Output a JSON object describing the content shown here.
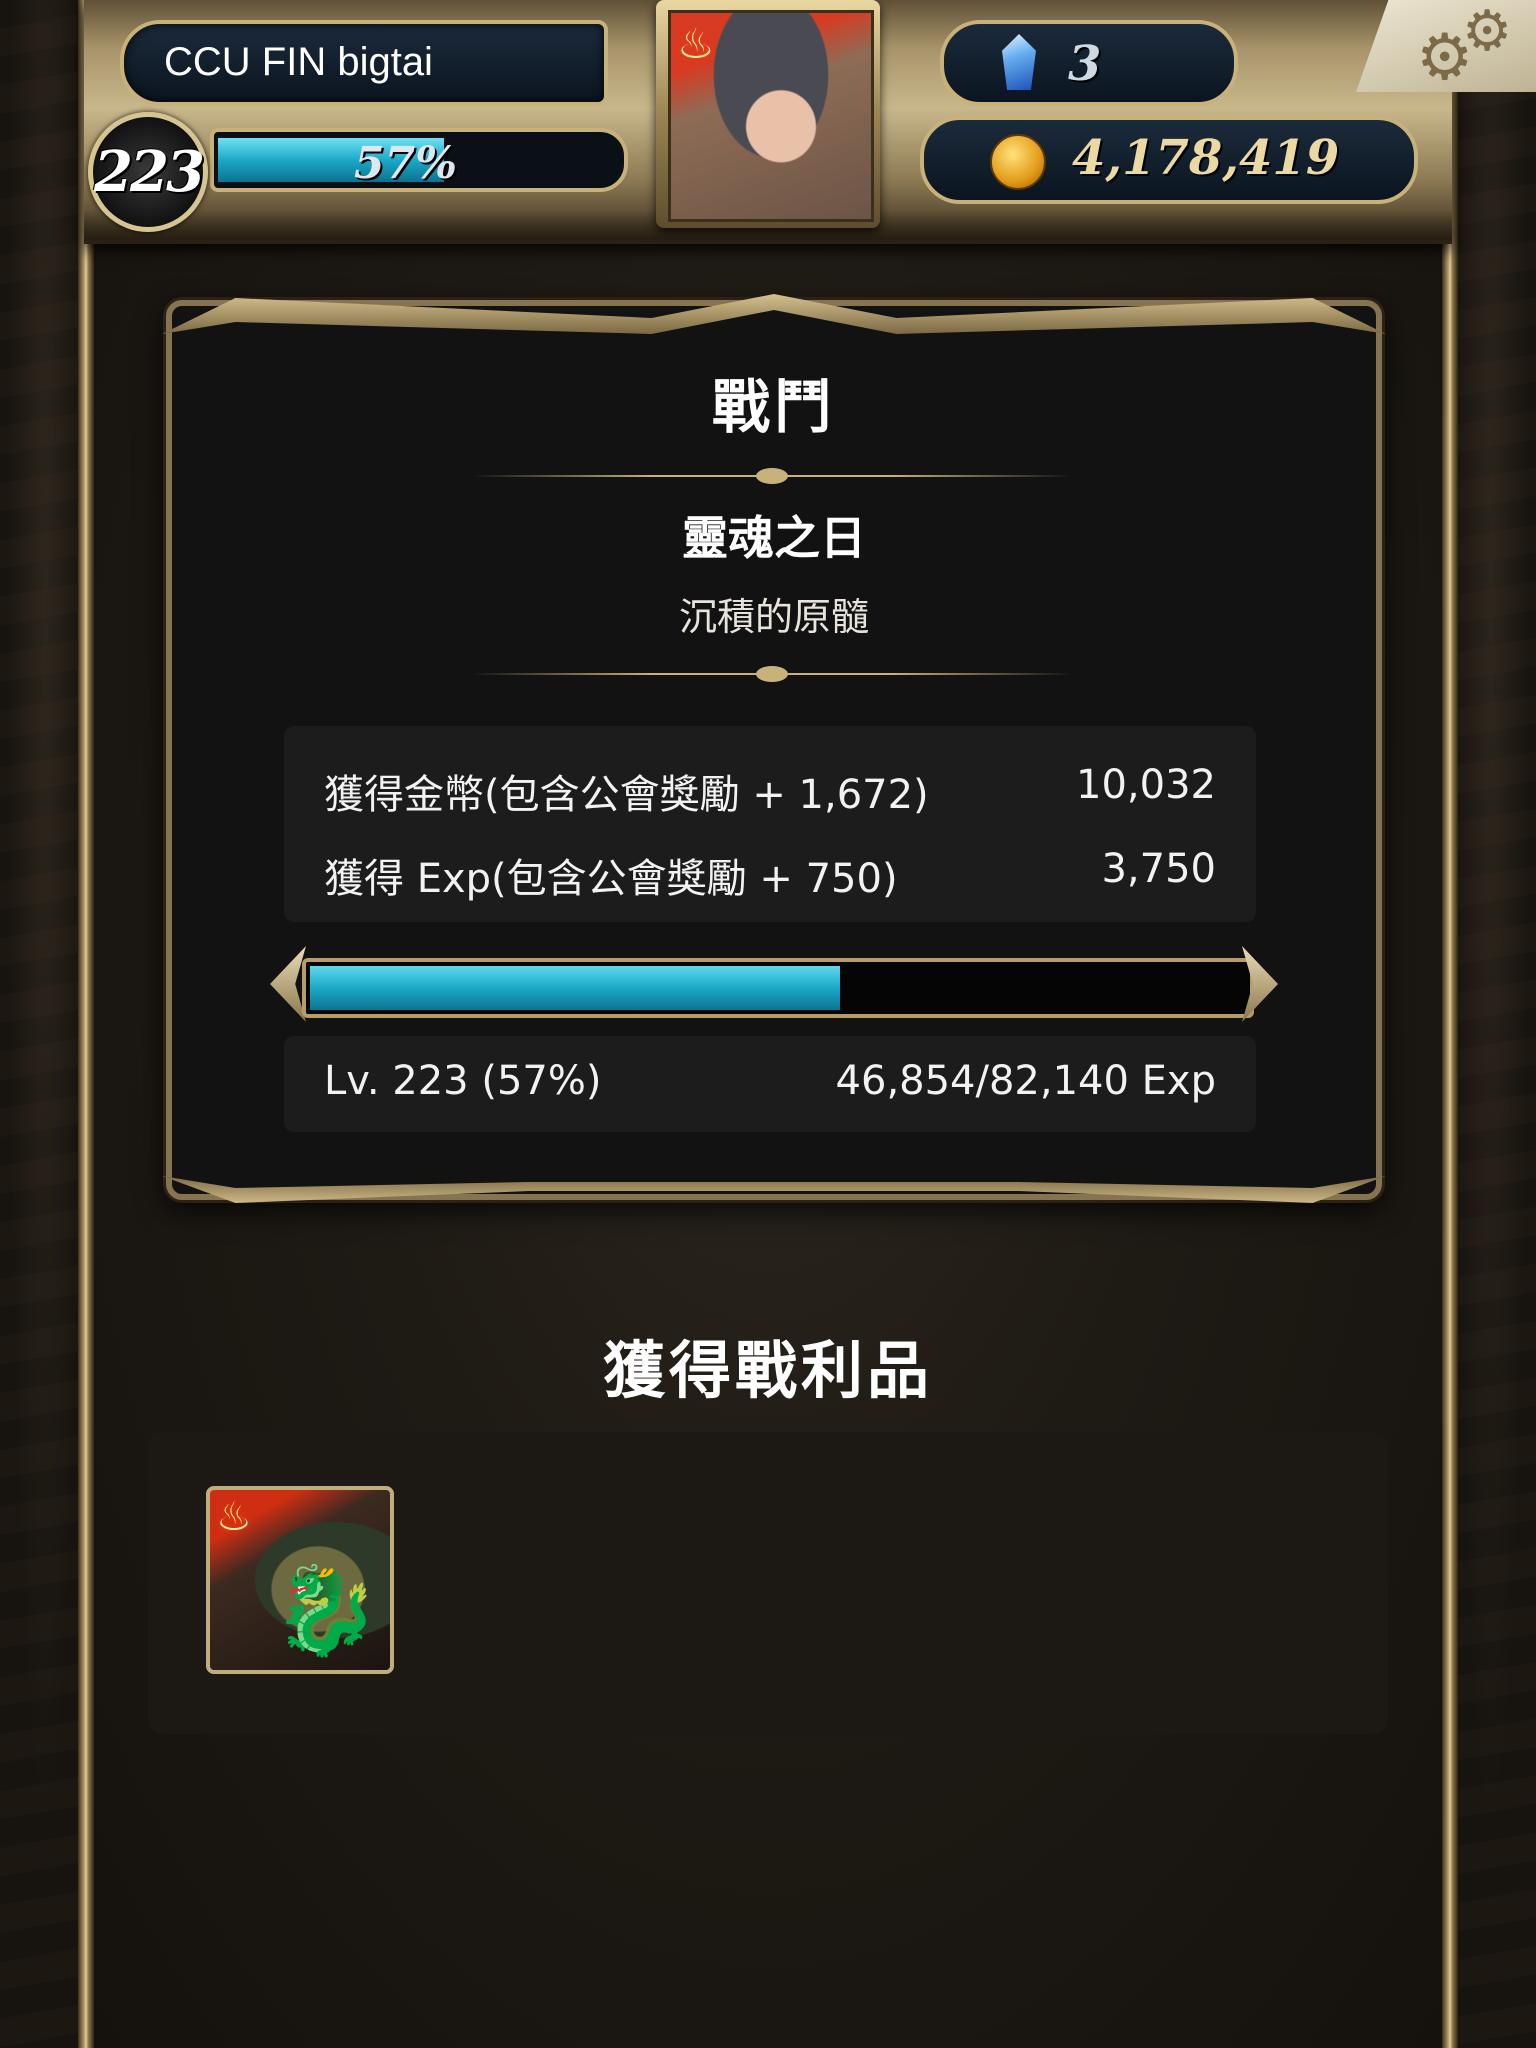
{
  "player": {
    "name": "CCU FIN bigtai",
    "level": "223",
    "exp_percent_label": "57%",
    "exp_fraction": 0.57
  },
  "currency": {
    "crystals": "3",
    "gold": "4,178,419"
  },
  "icons": {
    "crystal": "blue-crystal-icon",
    "gold": "gold-coin-icon",
    "settings": "gear-icon",
    "element": "fire-element-icon"
  },
  "battle": {
    "title": "戰鬥",
    "stage_name": "靈魂之日",
    "stage_subtitle": "沉積的原髓",
    "rewards": [
      {
        "label": "獲得金幣(包含公會獎勵 + 1,672)",
        "value": "10,032"
      },
      {
        "label": "獲得 Exp(包含公會獎勵 + 750)",
        "value": "3,750"
      }
    ],
    "level_text": "Lv. 223 (57%)",
    "exp_text": "46,854/82,140 Exp",
    "exp_progress": 0.57
  },
  "loot": {
    "title": "獲得戰利品",
    "items": [
      {
        "name": "dragon-card",
        "element": "fire"
      }
    ]
  },
  "colors": {
    "accent_bar": "#1aa9c7",
    "frame_gold": "#c8b27a",
    "panel_bg": "#121212"
  }
}
